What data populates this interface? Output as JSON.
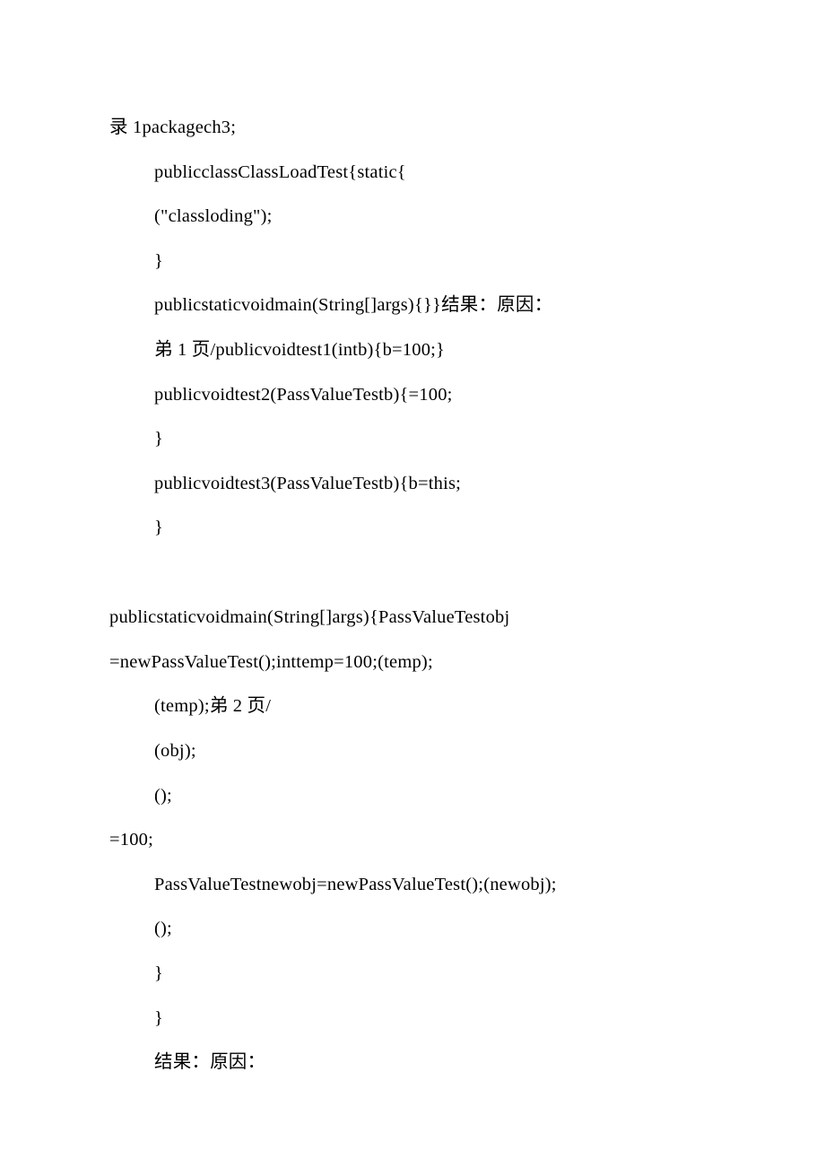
{
  "lines": {
    "l1": "录 1packagech3;",
    "l2": "publicclassClassLoadTest{static{",
    "l3": "(\"classloding\");",
    "l4": "}",
    "l5": "publicstaticvoidmain(String[]args){}}结果：原因：",
    "l6": "弟 1 页/publicvoidtest1(intb){b=100;}",
    "l7": "publicvoidtest2(PassValueTestb){=100;",
    "l8": "}",
    "l9": "publicvoidtest3(PassValueTestb){b=this;",
    "l10": "}",
    "l11": "publicstaticvoidmain(String[]args){PassValueTestobj",
    "l12": "=newPassValueTest();inttemp=100;(temp);",
    "l13": "(temp);弟 2 页/",
    "l14": "(obj);",
    "l15": "();",
    "l16": "=100;",
    "l17": " PassValueTestnewobj=newPassValueTest();(newobj);",
    "l18": "();",
    "l19": "}",
    "l20": "}",
    "l21": "结果：原因："
  }
}
